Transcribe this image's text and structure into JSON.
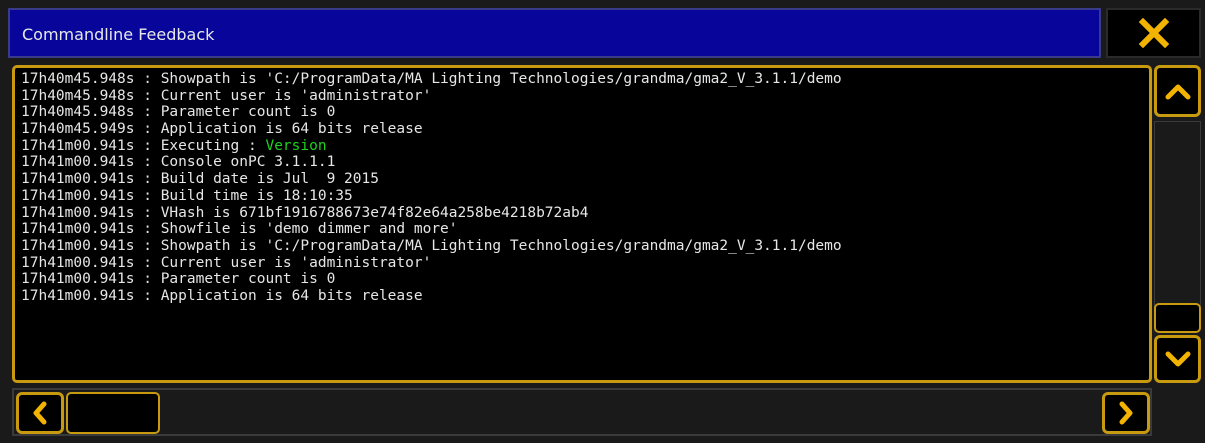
{
  "window": {
    "title": "Commandline Feedback"
  },
  "icons": {
    "close": "close-icon",
    "scroll_up": "chevron-up-icon",
    "scroll_down": "chevron-down-icon",
    "scroll_left": "chevron-left-icon",
    "scroll_right": "chevron-right-icon"
  },
  "colors": {
    "title_bar": "#08069a",
    "accent": "#c89a10",
    "text": "#e6e6e6",
    "highlight": "#1ed01e"
  },
  "log": [
    {
      "time": "17h40m45.948s",
      "msg": "Showpath is 'C:/ProgramData/MA Lighting Technologies/grandma/gma2_V_3.1.1/demo"
    },
    {
      "time": "17h40m45.948s",
      "msg": "Current user is 'administrator'"
    },
    {
      "time": "17h40m45.948s",
      "msg": "Parameter count is 0"
    },
    {
      "time": "17h40m45.949s",
      "msg": "Application is 64 bits release"
    },
    {
      "time": "17h41m00.941s",
      "msg": "Executing : ",
      "highlight": "Version"
    },
    {
      "time": "17h41m00.941s",
      "msg": "Console onPC 3.1.1.1"
    },
    {
      "time": "17h41m00.941s",
      "msg": "Build date is Jul  9 2015"
    },
    {
      "time": "17h41m00.941s",
      "msg": "Build time is 18:10:35"
    },
    {
      "time": "17h41m00.941s",
      "msg": "VHash is 671bf1916788673e74f82e64a258be4218b72ab4"
    },
    {
      "time": "17h41m00.941s",
      "msg": "Showfile is 'demo dimmer and more'"
    },
    {
      "time": "17h41m00.941s",
      "msg": "Showpath is 'C:/ProgramData/MA Lighting Technologies/grandma/gma2_V_3.1.1/demo"
    },
    {
      "time": "17h41m00.941s",
      "msg": "Current user is 'administrator'"
    },
    {
      "time": "17h41m00.941s",
      "msg": "Parameter count is 0"
    },
    {
      "time": "17h41m00.941s",
      "msg": "Application is 64 bits release"
    }
  ]
}
